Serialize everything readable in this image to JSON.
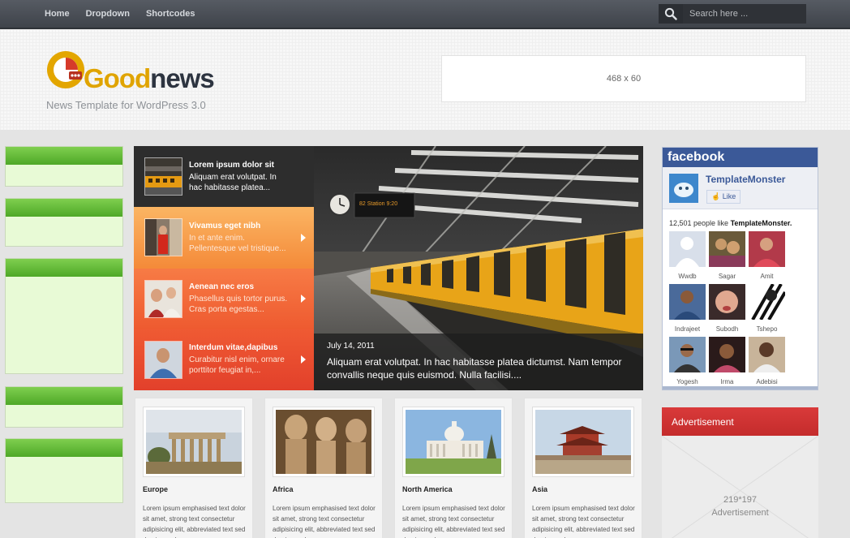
{
  "nav": {
    "items": [
      "Home",
      "Dropdown",
      "Shortcodes"
    ]
  },
  "search": {
    "placeholder": "Search here ..."
  },
  "logo": {
    "word_a": "Good",
    "word_b": "news",
    "tagline": "News Template for WordPress 3.0"
  },
  "banner": {
    "label": "468 x 60"
  },
  "slider": {
    "items": [
      {
        "title": "Lorem ipsum dolor sit",
        "line1": "Aliquam erat volutpat. In",
        "line2": "hac habitasse platea..."
      },
      {
        "title": "Vivamus eget nibh",
        "line1": "In et ante enim.",
        "line2": "Pellentesque vel tristique..."
      },
      {
        "title": "Aenean nec eros",
        "line1": "Phasellus quis tortor purus.",
        "line2": "Cras porta egestas..."
      },
      {
        "title": "Interdum vitae,dapibus",
        "line1": "Curabitur nisl enim, ornare",
        "line2": "porttitor feugiat in,..."
      }
    ],
    "caption": {
      "date": "July 14, 2011",
      "text": "Aliquam erat volutpat. In hac habitasse platea dictumst. Nam tempor convallis neque quis euismod. Nulla facilisi...."
    },
    "station_sign": "82 Station 9:20"
  },
  "cards": [
    {
      "title": "Europe",
      "text": "Lorem ipsum emphasised text dolor sit amet, strong text consectetur adipisicing elit, abbreviated text sed do eiusmod"
    },
    {
      "title": "Africa",
      "text": "Lorem ipsum emphasised text dolor sit amet, strong text consectetur adipisicing elit, abbreviated text sed do eiusmod"
    },
    {
      "title": "North America",
      "text": "Lorem ipsum emphasised text dolor sit amet, strong text consectetur adipisicing elit, abbreviated text sed do eiusmod"
    },
    {
      "title": "Asia",
      "text": "Lorem ipsum emphasised text dolor sit amet, strong text consectetur adipisicing elit, abbreviated text sed do eiusmod"
    }
  ],
  "facebook": {
    "header": "facebook",
    "page_name": "TemplateMonster",
    "like_label": "Like",
    "count_prefix": "12,501 people like ",
    "count_name": "TemplateMonster.",
    "fans": [
      "Wwdb",
      "Sagar",
      "Amit",
      "Indrajeet",
      "Subodh",
      "Tshepo",
      "Yogesh",
      "Irma",
      "Adebisi"
    ]
  },
  "advertisement": {
    "title": "Advertisement",
    "size": "219*197",
    "label": "Advertisement"
  },
  "colors": {
    "topbar": "#4a4e55",
    "accent_orange": "#f48a39",
    "accent_red": "#e2402b",
    "facebook_blue": "#3b5998",
    "ad_red": "#c42c2c",
    "sidebar_green": "#4ea827"
  }
}
